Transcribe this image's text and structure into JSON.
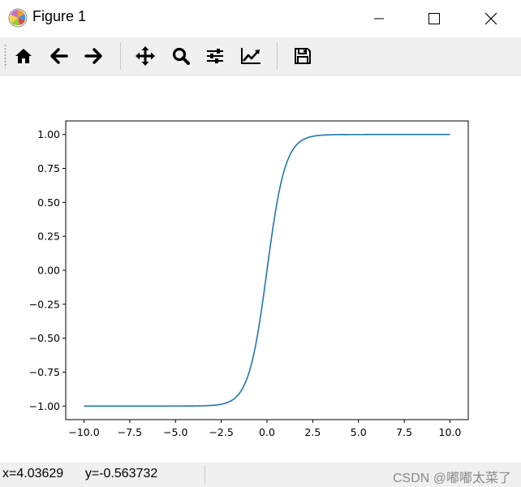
{
  "window": {
    "title": "Figure 1",
    "icon": "matplotlib-logo-icon"
  },
  "toolbar": {
    "buttons": [
      {
        "name": "home",
        "icon": "home-icon"
      },
      {
        "name": "back",
        "icon": "arrow-left-icon"
      },
      {
        "name": "forward",
        "icon": "arrow-right-icon"
      },
      {
        "name": "pan",
        "icon": "move-icon"
      },
      {
        "name": "zoom",
        "icon": "zoom-icon"
      },
      {
        "name": "configure-subplots",
        "icon": "sliders-icon"
      },
      {
        "name": "edit-axis",
        "icon": "line-chart-icon"
      },
      {
        "name": "save",
        "icon": "floppy-icon"
      }
    ]
  },
  "statusbar": {
    "coords": "x=4.03629      y=-0.563732",
    "watermark": "CSDN @嘟嘟太菜了"
  },
  "colors": {
    "line": "#1f77b4",
    "toolbar_bg": "#f0f0f0"
  },
  "chart_data": {
    "type": "line",
    "function_shape": "tanh",
    "x_start": -10.0,
    "x_end": 10.0,
    "sample_points": 200,
    "series": [
      {
        "x": [
          -10,
          -5,
          -3,
          -2.5,
          -2,
          -1.5,
          -1,
          -0.5,
          0,
          0.5,
          1,
          1.5,
          2,
          2.5,
          3,
          5,
          10
        ],
        "y": [
          -1.0,
          -0.9999,
          -0.9951,
          -0.9866,
          -0.964,
          -0.9051,
          -0.7616,
          -0.4621,
          0.0,
          0.4621,
          0.7616,
          0.9051,
          0.964,
          0.9866,
          0.9951,
          0.9999,
          1.0
        ]
      }
    ],
    "xlim": [
      -10.0,
      10.0
    ],
    "ylim": [
      -1.0,
      1.0
    ],
    "xticks": [
      "−10.0",
      "−7.5",
      "−5.0",
      "−2.5",
      "0.0",
      "2.5",
      "5.0",
      "7.5",
      "10.0"
    ],
    "xtick_values": [
      -10,
      -7.5,
      -5,
      -2.5,
      0,
      2.5,
      5,
      7.5,
      10
    ],
    "yticks": [
      "1.00",
      "0.75",
      "0.50",
      "0.25",
      "0.00",
      "−0.25",
      "−0.50",
      "−0.75",
      "−1.00"
    ],
    "ytick_values": [
      1.0,
      0.75,
      0.5,
      0.25,
      0.0,
      -0.25,
      -0.5,
      -0.75,
      -1.0
    ],
    "grid": false,
    "title": "",
    "xlabel": "",
    "ylabel": ""
  }
}
